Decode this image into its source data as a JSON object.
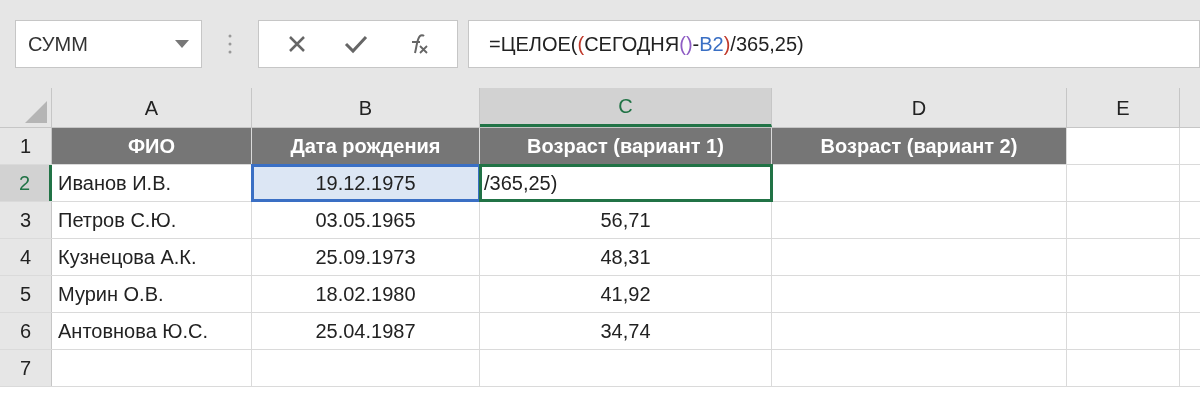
{
  "name_box": {
    "value": "СУММ"
  },
  "formula_bar": {
    "tokens": [
      {
        "text": "=ЦЕЛОЕ(",
        "color": "#222222"
      },
      {
        "text": "(",
        "color": "#c0392b"
      },
      {
        "text": "СЕГОДНЯ",
        "color": "#222222"
      },
      {
        "text": "()",
        "color": "#8e5cc4"
      },
      {
        "text": "-",
        "color": "#222222"
      },
      {
        "text": "B2",
        "color": "#3a6fc4"
      },
      {
        "text": ")",
        "color": "#c0392b"
      },
      {
        "text": "/365,25)",
        "color": "#222222"
      }
    ]
  },
  "columns": [
    {
      "label": "A",
      "selected": false
    },
    {
      "label": "B",
      "selected": false
    },
    {
      "label": "C",
      "selected": true
    },
    {
      "label": "D",
      "selected": false
    },
    {
      "label": "E",
      "selected": false
    }
  ],
  "rows": [
    {
      "label": "1",
      "selected": false,
      "kind": "header",
      "cells": [
        "ФИО",
        "Дата рождения",
        "Возраст (вариант 1)",
        "Возраст (вариант 2)",
        ""
      ]
    },
    {
      "label": "2",
      "selected": true,
      "kind": "data",
      "cells": [
        "Иванов И.В.",
        "19.12.1975",
        "/365,25)",
        "",
        ""
      ]
    },
    {
      "label": "3",
      "selected": false,
      "kind": "data",
      "cells": [
        "Петров С.Ю.",
        "03.05.1965",
        "56,71",
        "",
        ""
      ]
    },
    {
      "label": "4",
      "selected": false,
      "kind": "data",
      "cells": [
        "Кузнецова А.К.",
        "25.09.1973",
        "48,31",
        "",
        ""
      ]
    },
    {
      "label": "5",
      "selected": false,
      "kind": "data",
      "cells": [
        "Мурин О.В.",
        "18.02.1980",
        "41,92",
        "",
        ""
      ]
    },
    {
      "label": "6",
      "selected": false,
      "kind": "data",
      "cells": [
        "Антовнова Ю.С.",
        "25.04.1987",
        "34,74",
        "",
        ""
      ]
    },
    {
      "label": "7",
      "selected": false,
      "kind": "data",
      "cells": [
        "",
        "",
        "",
        "",
        ""
      ]
    }
  ]
}
